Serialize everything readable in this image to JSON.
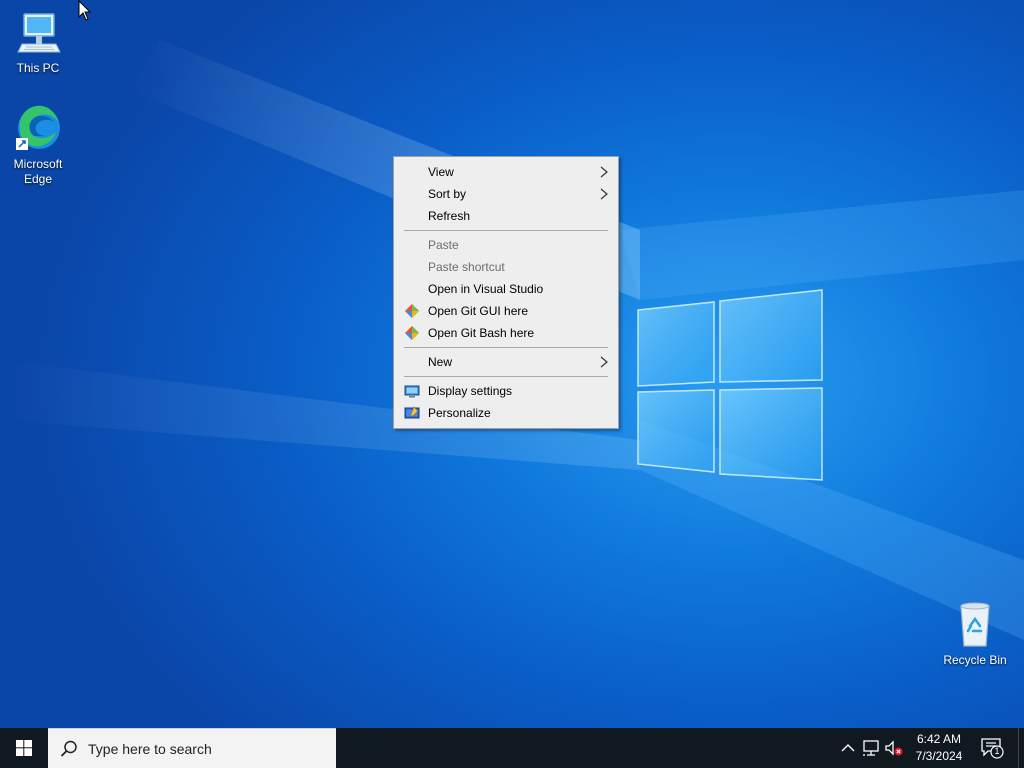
{
  "desktop": {
    "icons": [
      {
        "label": "This PC",
        "icon": "this-pc-icon"
      },
      {
        "label": "Microsoft\nEdge",
        "icon": "edge-icon"
      },
      {
        "label": "Recycle Bin",
        "icon": "recycle-bin-icon"
      }
    ]
  },
  "context_menu": {
    "items": [
      {
        "label": "View",
        "submenu": true,
        "disabled": false
      },
      {
        "label": "Sort by",
        "submenu": true,
        "disabled": false
      },
      {
        "label": "Refresh",
        "submenu": false,
        "disabled": false
      },
      {
        "label": "Paste",
        "submenu": false,
        "disabled": true
      },
      {
        "label": "Paste shortcut",
        "submenu": false,
        "disabled": true
      },
      {
        "label": "Open in Visual Studio",
        "submenu": false,
        "disabled": false
      },
      {
        "label": "Open Git GUI here",
        "icon": "git-gui-icon",
        "disabled": false
      },
      {
        "label": "Open Git Bash here",
        "icon": "git-bash-icon",
        "disabled": false
      },
      {
        "label": "New",
        "submenu": true,
        "disabled": false
      },
      {
        "label": "Display settings",
        "icon": "display-settings-icon",
        "disabled": false
      },
      {
        "label": "Personalize",
        "icon": "personalize-icon",
        "disabled": false
      }
    ]
  },
  "taskbar": {
    "search_placeholder": "Type here to search",
    "time": "6:42 AM",
    "date": "7/3/2024",
    "notification_count": "1",
    "tray_icons": [
      "chevron-up-icon",
      "network-icon",
      "volume-muted-icon"
    ]
  },
  "colors": {
    "desktop_blue": "#0f79dd",
    "taskbar": "#101820",
    "menu_bg": "#eeeeee",
    "disabled_text": "#6d6d6d"
  }
}
